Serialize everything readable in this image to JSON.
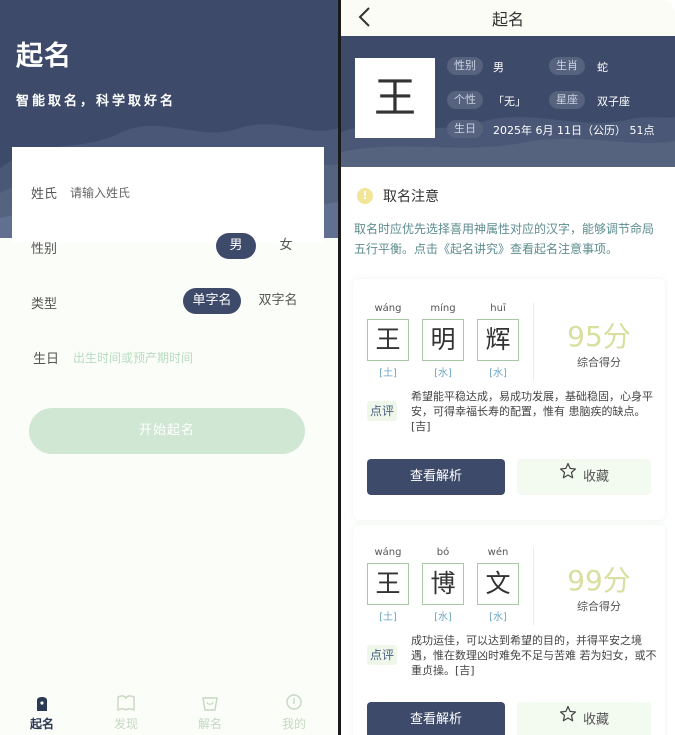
{
  "left": {
    "title": "起名",
    "subtitle": "智能取名，科学取好名",
    "surname_label": "姓氏",
    "surname_placeholder": "请输入姓氏",
    "gender_label": "性别",
    "gender_options": [
      "男",
      "女"
    ],
    "gender_selected": "男",
    "type_label": "类型",
    "type_options": [
      "单字名",
      "双字名"
    ],
    "type_selected": "单字名",
    "birthday_label": "生日",
    "birthday_placeholder": "出生时间或预产期时间",
    "start_button": "开始起名",
    "tabs": [
      {
        "label": "起名",
        "icon": "pen-tip-icon",
        "active": true
      },
      {
        "label": "发现",
        "icon": "book-icon",
        "active": false
      },
      {
        "label": "解名",
        "icon": "bag-icon",
        "active": false
      },
      {
        "label": "我的",
        "icon": "user-icon",
        "active": false
      }
    ]
  },
  "right": {
    "nav_title": "起名",
    "surname": "王",
    "info": {
      "gender_tag": "性别",
      "gender_value": "男",
      "zodiac_tag": "生肖",
      "zodiac_value": "蛇",
      "personality_tag": "个性",
      "personality_value": "「无」",
      "constellation_tag": "星座",
      "constellation_value": "双子座",
      "birth_tag": "生日",
      "birth_value": "2025年 6月 11日（公历） 51点"
    },
    "notice_icon": "!",
    "notice_title": "取名注意",
    "notice_text": "取名时应优先选择喜用神属性对应的汉字，能够调节命局五行平衡。点击《起名讲究》查看起名注意事项。",
    "comment_tag": "点评",
    "score_label": "综合得分",
    "detail_button": "查看解析",
    "fav_button": "收藏",
    "names": [
      {
        "chars": [
          {
            "char": "王",
            "pinyin": "wáng",
            "element": "[土]"
          },
          {
            "char": "明",
            "pinyin": "míng",
            "element": "[水]"
          },
          {
            "char": "辉",
            "pinyin": "huī",
            "element": "[水]"
          }
        ],
        "score": "95分",
        "comment": "希望能平稳达成，易成功发展，基础稳固，心身平安，可得幸福长寿的配置，惟有 患脑疾的缺点。[吉]"
      },
      {
        "chars": [
          {
            "char": "王",
            "pinyin": "wáng",
            "element": "[土]"
          },
          {
            "char": "博",
            "pinyin": "bó",
            "element": "[水]"
          },
          {
            "char": "文",
            "pinyin": "wén",
            "element": "[水]"
          }
        ],
        "score": "99分",
        "comment": "成功运佳，可以达到希望的目的，并得平安之境遇，惟在数理凶时难免不足与苦难 若为妇女，或不重贞操。[吉]"
      }
    ]
  },
  "colors": {
    "navy": "#3d4a69",
    "mint": "#cfe7d3",
    "score": "#d9df9f",
    "element_blue": "#6da6c3"
  }
}
